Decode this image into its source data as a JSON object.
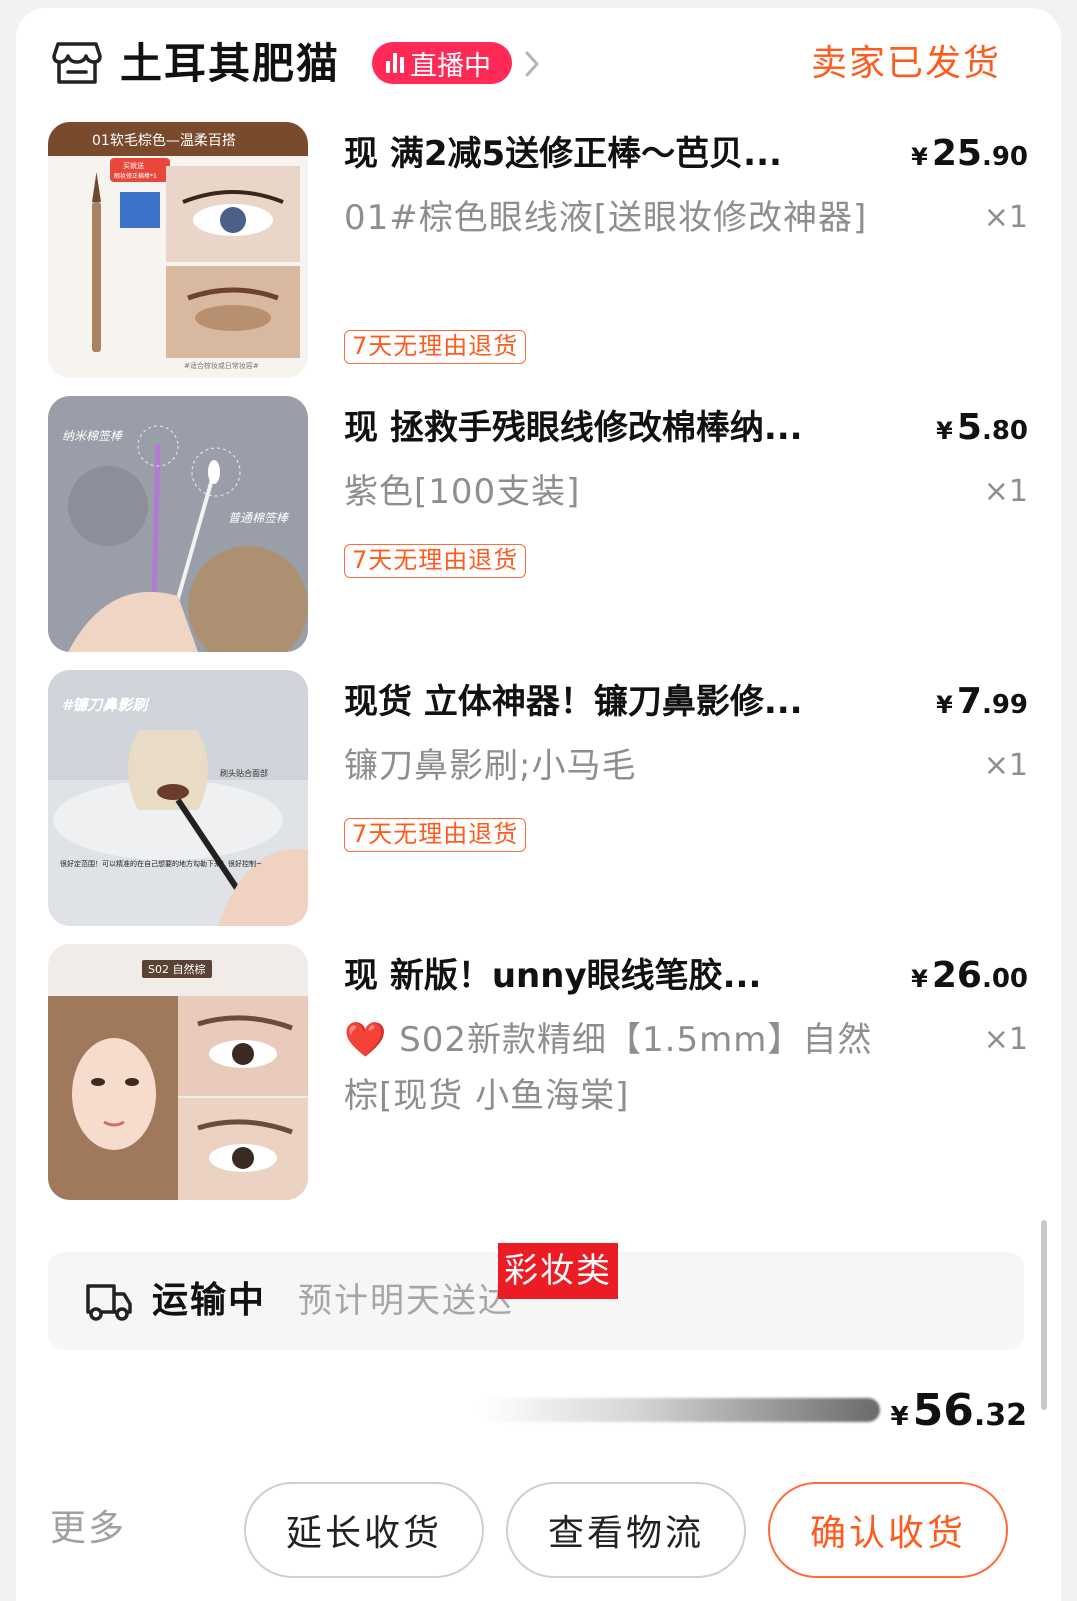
{
  "store": {
    "name": "土耳其肥猫",
    "live_label": "直播中",
    "order_status": "卖家已发货"
  },
  "items": [
    {
      "title": "现 满2减5送修正棒～芭贝...",
      "price_int": "25",
      "price_dec": ".90",
      "spec": "01#棕色眼线液[送眼妆修改神器]",
      "qty": "×1",
      "tag": "7天无理由退货",
      "thumb_text": [
        "01软毛棕色—温柔百搭",
        "买就送",
        "眼妆修正棉棒*1",
        "#适合棕妆或日常妆容#"
      ]
    },
    {
      "title": "现 拯救手残眼线修改棉棒纳...",
      "price_int": "5",
      "price_dec": ".80",
      "spec": "紫色[100支装]",
      "qty": "×1",
      "tag": "7天无理由退货",
      "thumb_text": [
        "纳米棉签棒",
        "普通棉签棒"
      ]
    },
    {
      "title": "现货 立体神器！镰刀鼻影修...",
      "price_int": "7",
      "price_dec": ".99",
      "spec": "镰刀鼻影刷;小马毛",
      "qty": "×1",
      "tag": "7天无理由退货",
      "thumb_text": [
        "#镰刀鼻影刷",
        "刷头贴合面部",
        "很好定范围！可以精准的在自己想要的地方勾勒下来！很好控制~"
      ]
    },
    {
      "title": "现 新版！unny眼线笔胶...",
      "price_int": "26",
      "price_dec": ".00",
      "spec_heart": "❤️",
      "spec": "S02新款精细【1.5mm】自然棕[现货 小鱼海棠]",
      "qty": "×1",
      "thumb_text": [
        "S02 自然棕"
      ]
    }
  ],
  "currency": "¥",
  "shipping": {
    "status": "运输中",
    "eta": "预计明天送达"
  },
  "category_tag": "彩妆类",
  "total": {
    "int": "56",
    "dec": ".32"
  },
  "actions": {
    "more": "更多",
    "extend": "延长收货",
    "logistics": "查看物流",
    "confirm": "确认收货"
  },
  "colors": {
    "accent": "#ff5b1f",
    "live_badge": "#ff2a55",
    "category_tag": "#ec1c24"
  },
  "icons": [
    "store-icon",
    "live-bars-icon",
    "chevron-right-icon",
    "truck-icon",
    "heart-icon"
  ]
}
